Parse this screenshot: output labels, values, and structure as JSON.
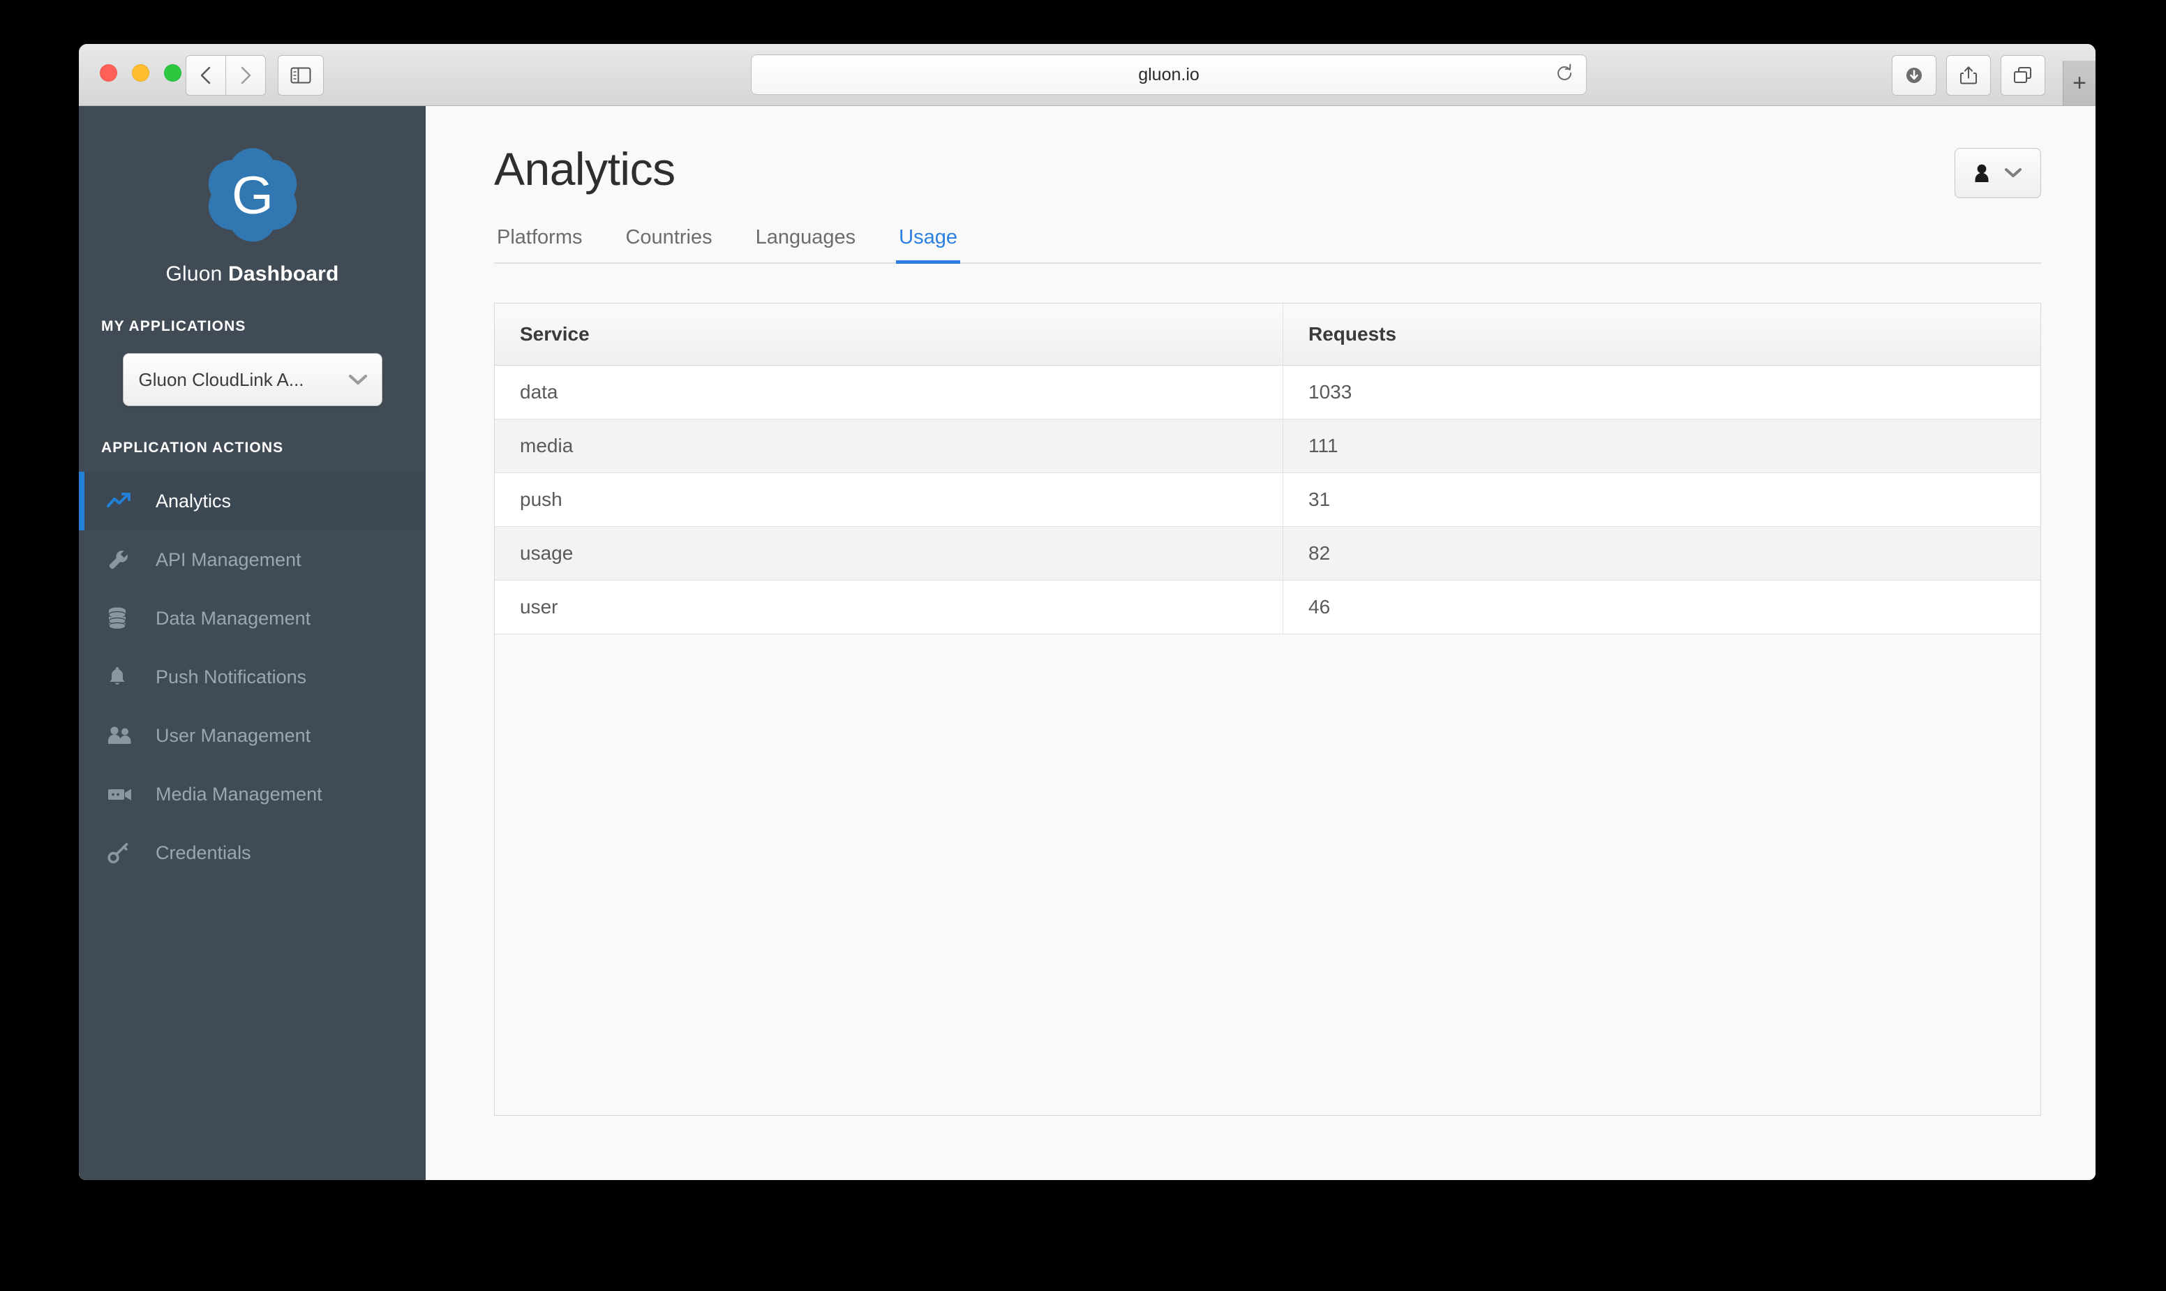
{
  "browser": {
    "url": "gluon.io",
    "traffic_lights": [
      "close",
      "minimize",
      "zoom"
    ],
    "back_label": "‹",
    "forward_label": "›",
    "newtab_label": "+",
    "icons": {
      "sidebar_toggle": "sidebar-toggle-icon",
      "reload": "reload-icon",
      "downloads": "downloads-icon",
      "share": "share-icon",
      "tab_overview": "tab-overview-icon"
    }
  },
  "sidebar": {
    "brand_light": "Gluon",
    "brand_bold": "Dashboard",
    "logo_letter": "G",
    "my_applications_label": "MY APPLICATIONS",
    "application_actions_label": "APPLICATION ACTIONS",
    "app_select_value": "Gluon CloudLink A...",
    "items": [
      {
        "label": "Analytics",
        "icon": "trend-up-icon",
        "active": true
      },
      {
        "label": "API Management",
        "icon": "wrench-icon",
        "active": false
      },
      {
        "label": "Data Management",
        "icon": "database-icon",
        "active": false
      },
      {
        "label": "Push Notifications",
        "icon": "bell-icon",
        "active": false
      },
      {
        "label": "User Management",
        "icon": "users-icon",
        "active": false
      },
      {
        "label": "Media Management",
        "icon": "video-icon",
        "active": false
      },
      {
        "label": "Credentials",
        "icon": "key-icon",
        "active": false
      }
    ]
  },
  "main": {
    "title": "Analytics",
    "tabs": [
      {
        "label": "Platforms",
        "active": false
      },
      {
        "label": "Countries",
        "active": false
      },
      {
        "label": "Languages",
        "active": false
      },
      {
        "label": "Usage",
        "active": true
      }
    ],
    "user_menu_icon": "user-icon",
    "user_menu_chevron": "chevron-down-icon"
  },
  "chart_data": {
    "type": "table",
    "title": "Usage",
    "columns": [
      "Service",
      "Requests"
    ],
    "categories": [
      "data",
      "media",
      "push",
      "usage",
      "user"
    ],
    "values": [
      1033,
      111,
      31,
      82,
      46
    ],
    "rows": [
      {
        "service": "data",
        "requests": "1033"
      },
      {
        "service": "media",
        "requests": "111"
      },
      {
        "service": "push",
        "requests": "31"
      },
      {
        "service": "usage",
        "requests": "82"
      },
      {
        "service": "user",
        "requests": "46"
      }
    ],
    "xlabel": "Service",
    "ylabel": "Requests"
  },
  "colors": {
    "accent": "#2a7fe0",
    "sidebar_bg": "#414b55",
    "sidebar_active_bg": "#3b4752",
    "content_bg": "#f9f9f9",
    "logo_blue": "#2f7fc1"
  }
}
